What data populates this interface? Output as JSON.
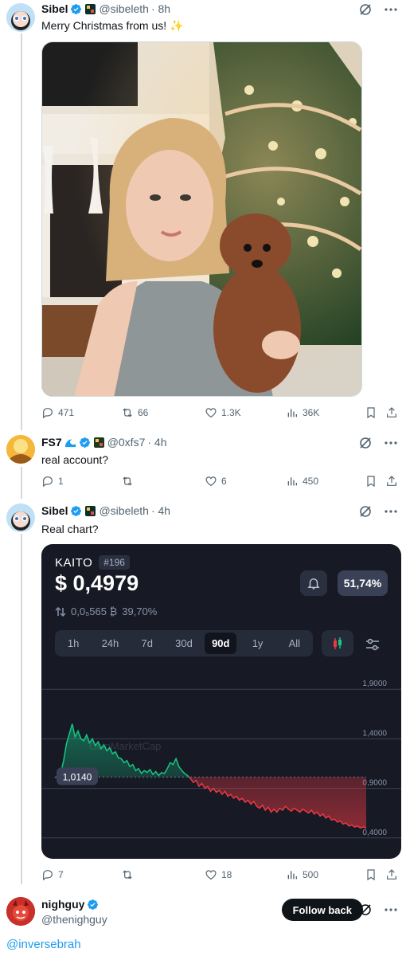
{
  "posts": [
    {
      "name": "Sibel",
      "handle": "@sibeleth",
      "time": "· 8h",
      "text": "Merry Christmas from us! ✨",
      "stats": {
        "replies": "471",
        "reposts": "66",
        "likes": "1.3K",
        "views": "36K"
      }
    },
    {
      "name": "FS7",
      "handle": "@0xfs7",
      "time": "· 4h",
      "text": "real account?",
      "stats": {
        "replies": "1",
        "reposts": "",
        "likes": "6",
        "views": "450"
      }
    },
    {
      "name": "Sibel",
      "handle": "@sibeleth",
      "time": "· 4h",
      "text": "Real chart?",
      "stats": {
        "replies": "7",
        "reposts": "",
        "likes": "18",
        "views": "500"
      }
    }
  ],
  "chart_card": {
    "ticker": "KAITO",
    "rank": "#196",
    "price": "$ 0,4979",
    "btc_price": "0,0₅565 ₿",
    "btc_change": "39,70%",
    "change_badge": "51,74%",
    "tabs": [
      "1h",
      "24h",
      "7d",
      "30d",
      "90d",
      "1y",
      "All"
    ],
    "active_tab": "90d",
    "watermark": "CoinMarketCap",
    "start_label": "1,0140"
  },
  "chart_data": {
    "type": "line",
    "title": "",
    "ylabel": "",
    "xlabel": "",
    "ylim": [
      0.35,
      1.95
    ],
    "y_ticks": [
      "1,9000",
      "1,4000",
      "0,9000",
      "0,4000"
    ],
    "y_tick_values": [
      1.9,
      1.4,
      0.9,
      0.4
    ],
    "reference_value": 1.014,
    "series": [
      {
        "values": [
          1.01,
          1.02,
          1.05,
          1.18,
          1.35,
          1.45,
          1.55,
          1.42,
          1.48,
          1.4,
          1.38,
          1.44,
          1.36,
          1.4,
          1.33,
          1.37,
          1.3,
          1.34,
          1.28,
          1.31,
          1.25,
          1.27,
          1.21,
          1.2,
          1.16,
          1.18,
          1.12,
          1.14,
          1.08,
          1.1,
          1.05,
          1.08,
          1.06,
          1.09,
          1.04,
          1.07,
          1.03,
          1.06,
          1.05,
          1.1,
          1.16,
          1.14,
          1.2,
          1.12,
          1.08,
          1.05,
          1.03,
          1.0,
          0.96,
          0.98,
          0.92,
          0.95,
          0.9,
          0.92,
          0.87,
          0.9,
          0.86,
          0.88,
          0.84,
          0.87,
          0.82,
          0.84,
          0.8,
          0.82,
          0.78,
          0.8,
          0.76,
          0.78,
          0.74,
          0.77,
          0.72,
          0.7,
          0.73,
          0.68,
          0.71,
          0.66,
          0.69,
          0.66,
          0.7,
          0.68,
          0.72,
          0.69,
          0.67,
          0.7,
          0.68,
          0.66,
          0.69,
          0.67,
          0.65,
          0.68,
          0.64,
          0.66,
          0.62,
          0.64,
          0.6,
          0.62,
          0.58,
          0.59,
          0.56,
          0.57,
          0.54,
          0.55,
          0.52,
          0.53,
          0.51,
          0.52,
          0.5,
          0.51,
          0.5
        ]
      }
    ]
  },
  "suggestion": {
    "name": "nighguy",
    "handle": "@thenighguy",
    "follow_label": "Follow back",
    "mention": "@inversebrah"
  },
  "colors": {
    "up": "#16c784",
    "down": "#ea3943",
    "verified": "#1d9bf0"
  }
}
